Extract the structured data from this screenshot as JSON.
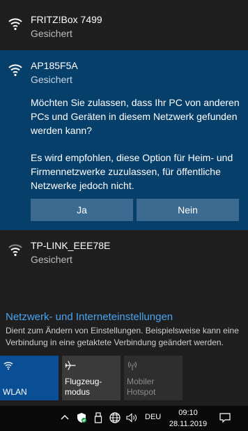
{
  "networks": [
    {
      "ssid": "FRITZ!Box 7499",
      "status": "Gesichert",
      "icon": "wifi-icon"
    },
    {
      "ssid": "AP185F5A",
      "status": "Gesichert",
      "icon": "wifi-icon",
      "question": "Möchten Sie zulassen, dass Ihr PC von anderen PCs und Geräten in diesem Netzwerk gefunden werden kann?",
      "recommendation": "Es wird empfohlen, diese Option für Heim- und Firmennetzwerke zuzulassen, für öffentliche Netzwerke jedoch nicht.",
      "yes_label": "Ja",
      "no_label": "Nein"
    },
    {
      "ssid": "TP-LINK_EEE78E",
      "status": "Gesichert",
      "icon": "wifi-icon"
    }
  ],
  "settings": {
    "link": "Netzwerk- und Interneteinstellungen",
    "description": "Dient zum Ändern von Einstellungen. Beispielsweise kann eine Verbindung in eine getaktete Verbindung geändert werden."
  },
  "quick_actions": [
    {
      "label": "WLAN",
      "icon": "wifi-icon",
      "active": true
    },
    {
      "label": "Flugzeug-\nmodus",
      "icon": "airplane-icon",
      "active": false
    },
    {
      "label": "Mobiler\nHotspot",
      "icon": "hotspot-icon",
      "active": false,
      "disabled": true
    }
  ],
  "taskbar": {
    "language": "DEU",
    "time": "09:10",
    "date": "28.11.2019",
    "icons": [
      "chevron-up-icon",
      "defender-icon",
      "usb-icon",
      "network-globe-icon",
      "volume-icon",
      "notification-icon"
    ]
  },
  "colors": {
    "panel_bg": "#1f1f1f",
    "selected_bg": "#073f6b",
    "button_bg": "#3c6a91",
    "link": "#4aa3f0",
    "tile_active": "#0a4f96",
    "tile_inactive": "#3a3a3a"
  }
}
